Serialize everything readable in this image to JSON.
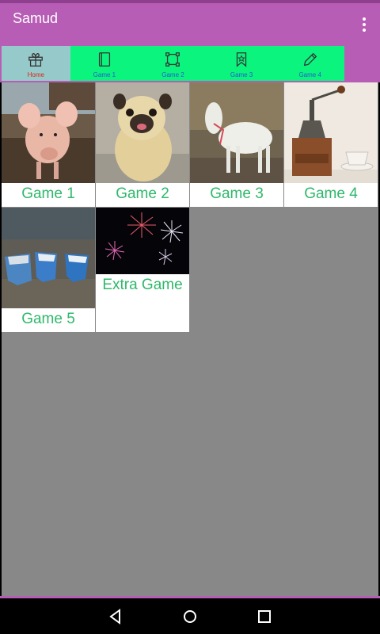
{
  "app": {
    "title": "Samud"
  },
  "tabs": [
    {
      "label": "Home",
      "icon": "gift-icon",
      "selected": true
    },
    {
      "label": "Game 1",
      "icon": "book-icon",
      "selected": false
    },
    {
      "label": "Game 2",
      "icon": "crop-frame-icon",
      "selected": false
    },
    {
      "label": "Game 3",
      "icon": "bookmark-star-icon",
      "selected": false
    },
    {
      "label": "Game 4",
      "icon": "pencil-icon",
      "selected": false
    }
  ],
  "games": [
    {
      "label": "Game 1",
      "image": "pig-photo"
    },
    {
      "label": "Game 2",
      "image": "pug-photo"
    },
    {
      "label": "Game 3",
      "image": "goat-photo"
    },
    {
      "label": "Game 4",
      "image": "coffee-grinder-photo"
    },
    {
      "label": "Game 5",
      "image": "rowboats-photo"
    },
    {
      "label": "Extra Game",
      "image": "fireworks-photo"
    }
  ],
  "colors": {
    "app_bar": "#b85db5",
    "tab_strip": "#0af47e",
    "tab_selected": "#96c9c9",
    "tab_label": "#2a58d6",
    "tab_label_selected": "#e0251b",
    "game_label": "#2fb86a",
    "content_bg": "#888888"
  }
}
